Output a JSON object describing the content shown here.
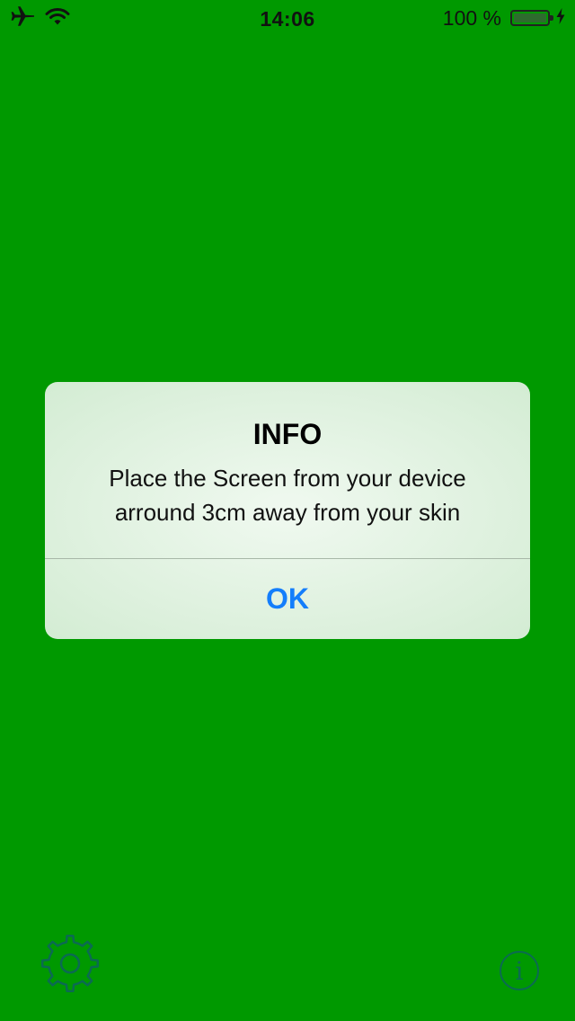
{
  "status_bar": {
    "time": "14:06",
    "battery_percent_text": "100 %",
    "battery_level": 1.0,
    "icons": [
      "airplane-icon",
      "wifi-icon",
      "battery-icon",
      "charging-bolt-icon"
    ]
  },
  "alert": {
    "title": "INFO",
    "message_line1": "Place the Screen from your device",
    "message_line2": "arround 3cm away from your skin",
    "ok_label": "OK"
  },
  "toolbar": {
    "settings_icon": "gear-icon",
    "info_icon": "info-icon"
  },
  "colors": {
    "background": "#009900",
    "alert_background": "#e4f4e4",
    "button_text": "#147efb",
    "toolbar_icon": "#0b6a52"
  }
}
